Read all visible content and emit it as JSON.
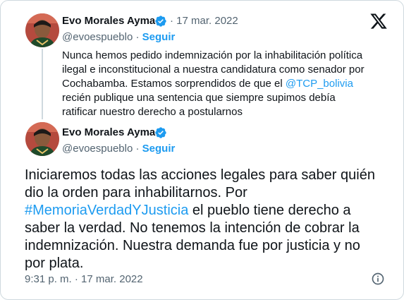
{
  "quoted_tweet": {
    "name": "Evo Morales Ayma",
    "handle": "@evoespueblo",
    "separator": "·",
    "follow_label": "Seguir",
    "date": "17 mar. 2022",
    "text_part1": "Nunca hemos pedido indemnización por la inhabilitación política ilegal e inconstitucional a nuestra candidatura como senador por Cochabamba. Estamos sorprendidos de que el ",
    "mention": "@TCP_bolivia",
    "text_part2": " recién publique una sentencia que siempre supimos debía ratificar nuestro derecho a postularnos"
  },
  "main_tweet": {
    "name": "Evo Morales Ayma",
    "handle": "@evoespueblo",
    "separator": "·",
    "follow_label": "Seguir",
    "text_part1": "Iniciaremos todas las acciones legales para saber quién dio la orden para inhabilitarnos. Por ",
    "hashtag": "#MemoriaVerdadYJusticia",
    "text_part2": " el pueblo tiene derecho a saber la verdad. No tenemos la intención de cobrar la indemnización. Nuestra demanda fue por justicia y no por plata.",
    "timestamp": "9:31 p. m. · 17 mar. 2022"
  },
  "icons": {
    "logo": "x-logo-icon",
    "verified": "verified-badge-icon",
    "info": "info-icon"
  },
  "colors": {
    "accent": "#1d9bf0",
    "text": "#0f1419",
    "muted": "#536471",
    "border": "#cfd9de"
  }
}
